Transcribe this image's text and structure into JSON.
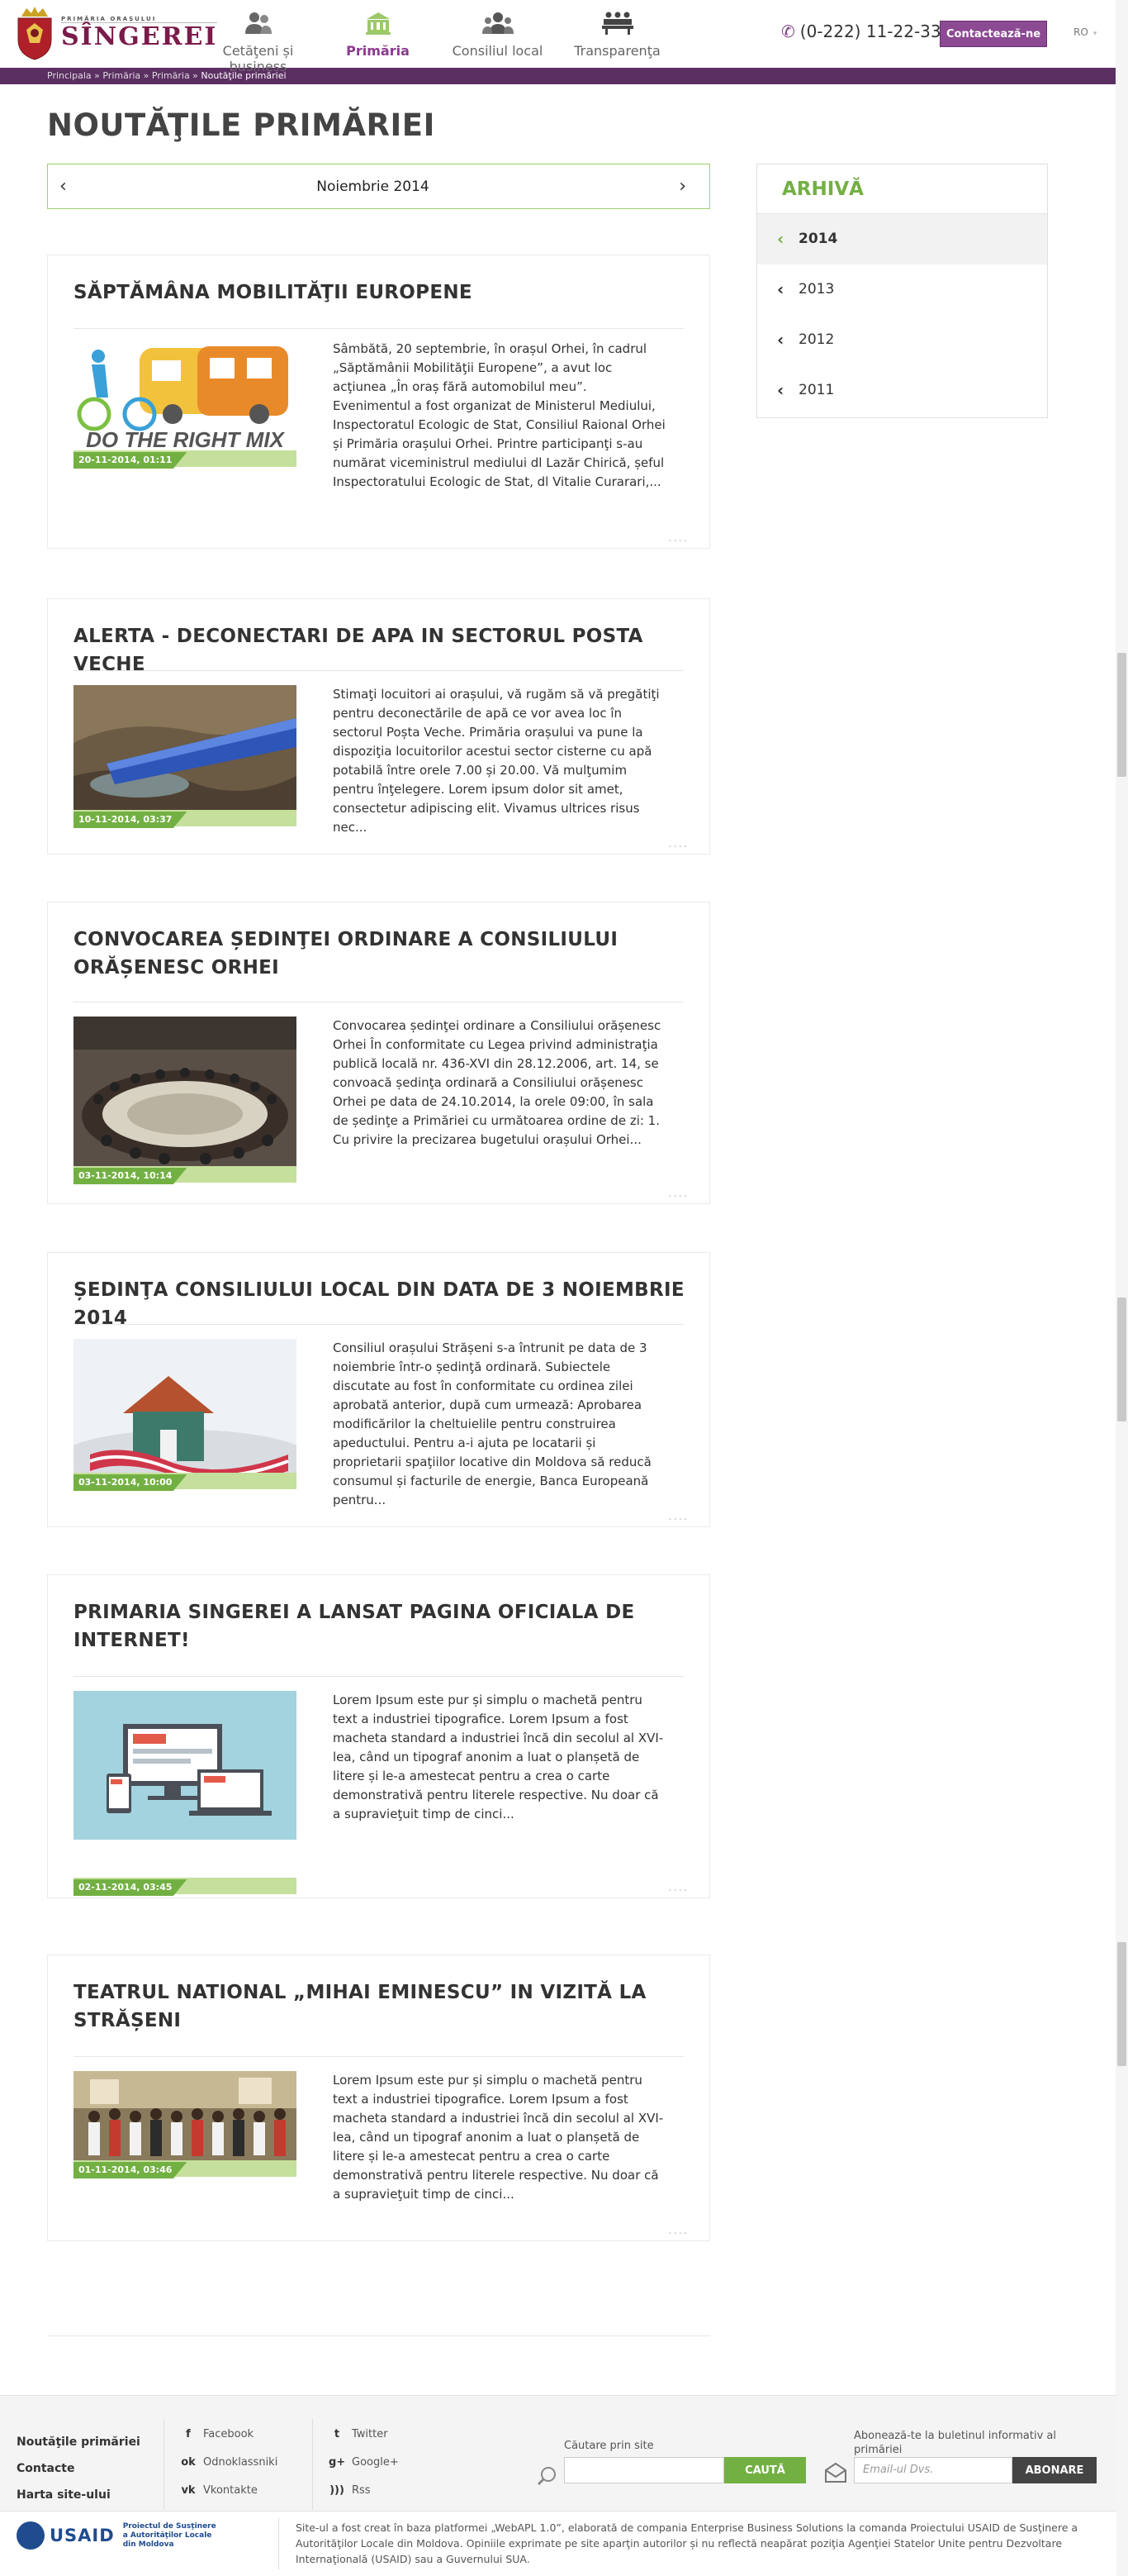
{
  "header": {
    "logo_small": "PRIMĂRIA ORAȘULUI",
    "logo_big": "SÎNGEREI",
    "nav": [
      {
        "label": "Cetăţeni și business",
        "icon": "people-icon"
      },
      {
        "label": "Primăria",
        "icon": "building-icon"
      },
      {
        "label": "Consiliul local",
        "icon": "group-icon"
      },
      {
        "label": "Transparenţa",
        "icon": "meeting-icon"
      }
    ],
    "phone": "(0-222) 11-22-33",
    "contact_btn": "Contactează-ne",
    "lang": "RO"
  },
  "breadcrumb": {
    "items": [
      "Principala",
      "Primăria",
      "Primăria"
    ],
    "sep": " » ",
    "current": "Noutăţile primăriei"
  },
  "page": {
    "title": "NOUTĂŢILE PRIMĂRIEI",
    "month": "Noiembrie 2014"
  },
  "news": [
    {
      "title": "SĂPTĂMÂNA MOBILITĂŢII EUROPENE",
      "date": "20-11-2014, 01:11",
      "image_caption": "DO THE RIGHT MIX",
      "excerpt": "Sâmbătă, 20 septembrie, în orașul Orhei, în cadrul „Săptămânii Mobilităţii Europene”, a avut loc acţiunea „În oraș fără automobilul meu”. Evenimentul a fost organizat de Ministerul Mediului, Inspectoratul Ecologic de Stat, Consiliul Raional Orhei și Primăria orașului Orhei. Printre participanţi s-au numărat viceministrul mediului dl Lazăr Chirică, șeful Inspectoratului Ecologic de Stat, dl Vitalie Curarari,...",
      "more": "...."
    },
    {
      "title": "ALERTA - DECONECTARI DE APA IN SECTORUL POSTA VECHE",
      "date": "10-11-2014, 03:37",
      "excerpt": "Stimaţi locuitori ai orașului, vă rugăm să vă pregătiţi pentru deconectările de apă ce vor avea loc în sectorul Poșta Veche. Primăria orașului va pune la dispoziţia locuitorilor acestui sector cisterne cu apă potabilă între orele 7.00 și 20.00. Vă mulţumim pentru înţelegere. Lorem ipsum dolor sit amet, consectetur adipiscing elit. Vivamus ultrices risus nec...",
      "more": "...."
    },
    {
      "title": "CONVOCAREA ȘEDINŢEI ORDINARE A CONSILIULUI ORĂȘENESC ORHEI",
      "date": "03-11-2014, 10:14",
      "excerpt": "Convocarea ședinţei ordinare a Consiliului orășenesc Orhei În conformitate cu Legea privind administraţia publică locală nr. 436-XVI din 28.12.2006, art. 14, se convoacă ședinţa ordinară a Consiliului orășenesc Orhei pe data de 24.10.2014, la orele 09:00, în sala de ședinţe a Primăriei cu următoarea ordine de zi: 1. Cu privire la precizarea bugetului orașului Orhei...",
      "more": "...."
    },
    {
      "title": "ȘEDINŢA CONSILIULUI LOCAL DIN DATA DE 3 NOIEMBRIE 2014",
      "date": "03-11-2014, 10:00",
      "excerpt": "Consiliul orașului Strășeni s-a întrunit pe data de 3 noiembrie într-o ședinţă ordinară. Subiectele discutate au fost în conformitate cu ordinea zilei aprobată anterior, după cum urmează: Aprobarea modificărilor la cheltuielile pentru construirea apeductului. Pentru a-i ajuta pe locatarii și proprietarii spaţiilor locative din Moldova să reducă consumul și facturile de energie, Banca Europeană pentru...",
      "more": "...."
    },
    {
      "title": "PRIMARIA SINGEREI A LANSAT PAGINA OFICIALA DE INTERNET!",
      "date": "02-11-2014, 03:45",
      "excerpt": "Lorem Ipsum este pur și simplu o machetă pentru text a industriei tipografice. Lorem Ipsum a fost macheta standard a industriei încă din secolul al XVI-lea, când un tipograf anonim a luat o planșetă de litere și le-a amestecat pentru a crea o carte demonstrativă pentru literele respective. Nu doar că a supravieţuit timp de cinci...",
      "more": "...."
    },
    {
      "title": "TEATRUL NATIONAL „MIHAI EMINESCU” IN VIZITĂ LA STRĂȘENI",
      "date": "01-11-2014, 03:46",
      "excerpt": "Lorem Ipsum este pur și simplu o machetă pentru text a industriei tipografice. Lorem Ipsum a fost macheta standard a industriei încă din secolul al XVI-lea, când un tipograf anonim a luat o planșetă de litere și le-a amestecat pentru a crea o carte demonstrativă pentru literele respective. Nu doar că a supravieţuit timp de cinci...",
      "more": "...."
    }
  ],
  "archive": {
    "title": "ARHIVĂ",
    "years": [
      "2014",
      "2013",
      "2012",
      "2011"
    ]
  },
  "footer": {
    "links": [
      "Noutăţile primăriei",
      "Contacte",
      "Harta site-ului"
    ],
    "social1": [
      {
        "label": "Facebook",
        "icon": "facebook-icon",
        "glyph": "f"
      },
      {
        "label": "Odnoklassniki",
        "icon": "odnoklassniki-icon",
        "glyph": "ok"
      },
      {
        "label": "Vkontakte",
        "icon": "vkontakte-icon",
        "glyph": "vk"
      }
    ],
    "social2": [
      {
        "label": "Twitter",
        "icon": "twitter-icon",
        "glyph": "t"
      },
      {
        "label": "Google+",
        "icon": "googleplus-icon",
        "glyph": "g+"
      },
      {
        "label": "Rss",
        "icon": "rss-icon",
        "glyph": ")))"
      }
    ],
    "search_label": "Căutare prin site",
    "search_btn": "CAUTĂ",
    "subscribe_label": "Abonează-te la buletinul informativ al primăriei",
    "subscribe_placeholder": "Email-ul Dvs.",
    "subscribe_btn": "ABONARE",
    "usaid_name": "USAID",
    "usaid_sub": "Proiectul de Susţinere a Autorităţilor Locale din Moldova",
    "credit": "Site-ul a fost creat în baza platformei „WebAPL 1.0”, elaborată de compania Enterprise Business Solutions la comanda Proiectului USAID de Susţinere a Autorităţilor Locale din Moldova. Opiniile exprimate pe site aparţin autorilor și nu reflectă neapărat poziţia Agenţiei Statelor Unite pentru Dezvoltare Internaţională (USAID) sau a Guvernului SUA."
  },
  "colors": {
    "purple": "#5c2f63",
    "button_purple": "#8b4a92",
    "green": "#73b043",
    "light_green": "#c5e09c"
  }
}
